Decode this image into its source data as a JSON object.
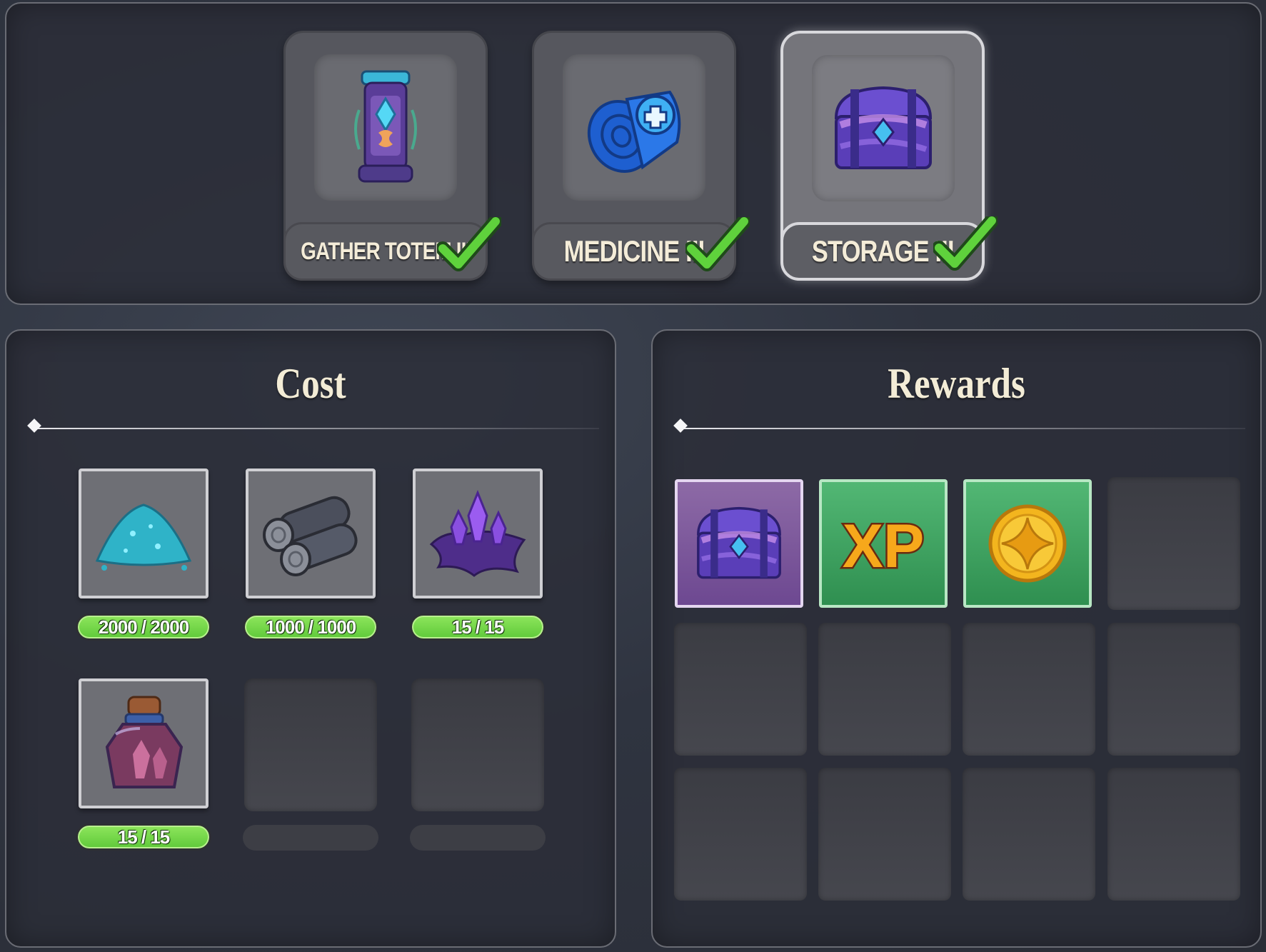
{
  "buildings": [
    {
      "name": "GATHER TOTEM III",
      "icon": "totem-icon",
      "completed": true,
      "selected": false
    },
    {
      "name": "MEDICINE III",
      "icon": "medicine-roll-icon",
      "completed": true,
      "selected": false
    },
    {
      "name": "STORAGE III",
      "icon": "storage-chest-icon",
      "completed": true,
      "selected": true
    }
  ],
  "cost": {
    "title": "Cost",
    "items": [
      {
        "icon": "blue-dust-icon",
        "count": "2000 / 2000"
      },
      {
        "icon": "dark-logs-icon",
        "count": "1000 / 1000"
      },
      {
        "icon": "purple-crystal-icon",
        "count": "15 / 15"
      },
      {
        "icon": "crystal-potion-icon",
        "count": "15 / 15"
      }
    ]
  },
  "rewards": {
    "title": "Rewards",
    "items": [
      {
        "icon": "storage-chest-icon",
        "rarity": "purple"
      },
      {
        "icon": "xp-icon",
        "label": "XP",
        "rarity": "green"
      },
      {
        "icon": "gold-coin-icon",
        "rarity": "green"
      }
    ]
  },
  "colors": {
    "check": "#5fd23c",
    "count_pill": "#6fd548",
    "reward_green": "#3ea463",
    "reward_purple": "#7d58a0"
  }
}
